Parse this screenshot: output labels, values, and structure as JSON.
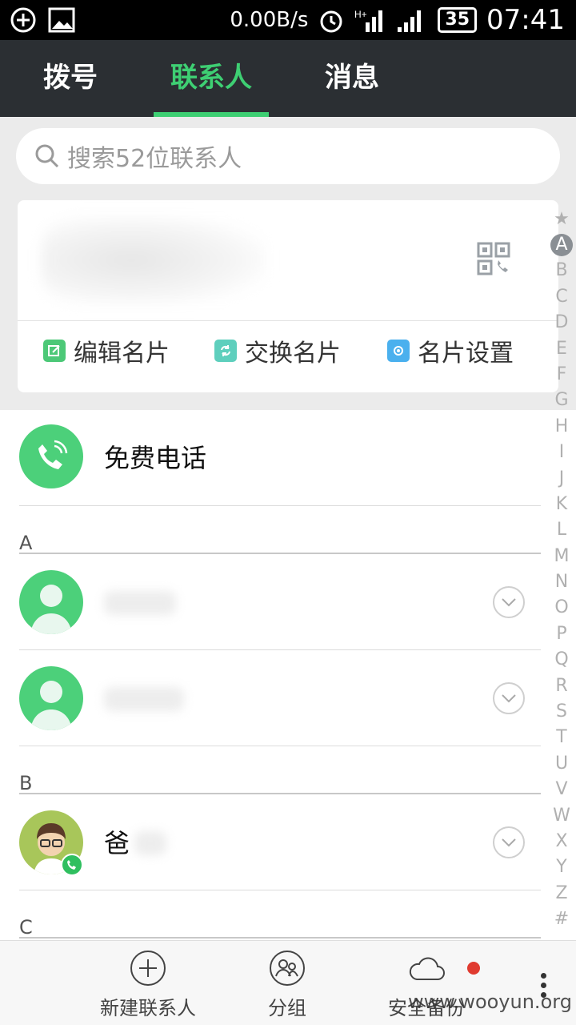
{
  "status_bar": {
    "speed": "0.00B/s",
    "battery": "35",
    "time": "07:41"
  },
  "tabs": [
    {
      "label": "拨号"
    },
    {
      "label": "联系人"
    },
    {
      "label": "消息"
    }
  ],
  "search": {
    "placeholder": "搜索52位联系人"
  },
  "card": {
    "actions": [
      {
        "label": "编辑名片",
        "icon": "edit-icon",
        "color": "#4cc877"
      },
      {
        "label": "交换名片",
        "icon": "exchange-icon",
        "color": "#5ecfbd"
      },
      {
        "label": "名片设置",
        "icon": "settings-icon",
        "color": "#4ab0ee"
      }
    ]
  },
  "free_call": {
    "label": "免费电话"
  },
  "sections": [
    {
      "letter": "A"
    },
    {
      "letter": "B"
    },
    {
      "letter": "C"
    }
  ],
  "contacts": [
    {
      "name": ""
    },
    {
      "name": ""
    },
    {
      "name": "爸"
    }
  ],
  "index": [
    "★",
    "A",
    "B",
    "C",
    "D",
    "E",
    "F",
    "G",
    "H",
    "I",
    "J",
    "K",
    "L",
    "M",
    "N",
    "O",
    "P",
    "Q",
    "R",
    "S",
    "T",
    "U",
    "V",
    "W",
    "X",
    "Y",
    "Z",
    "#"
  ],
  "bottom": {
    "new_contact": "新建联系人",
    "group": "分组",
    "backup": "安全备份",
    "watermark": "www.wooyun.org"
  },
  "colors": {
    "accent": "#3ecf73",
    "header_bg": "#2b2f33",
    "notify": "#e03b30"
  }
}
